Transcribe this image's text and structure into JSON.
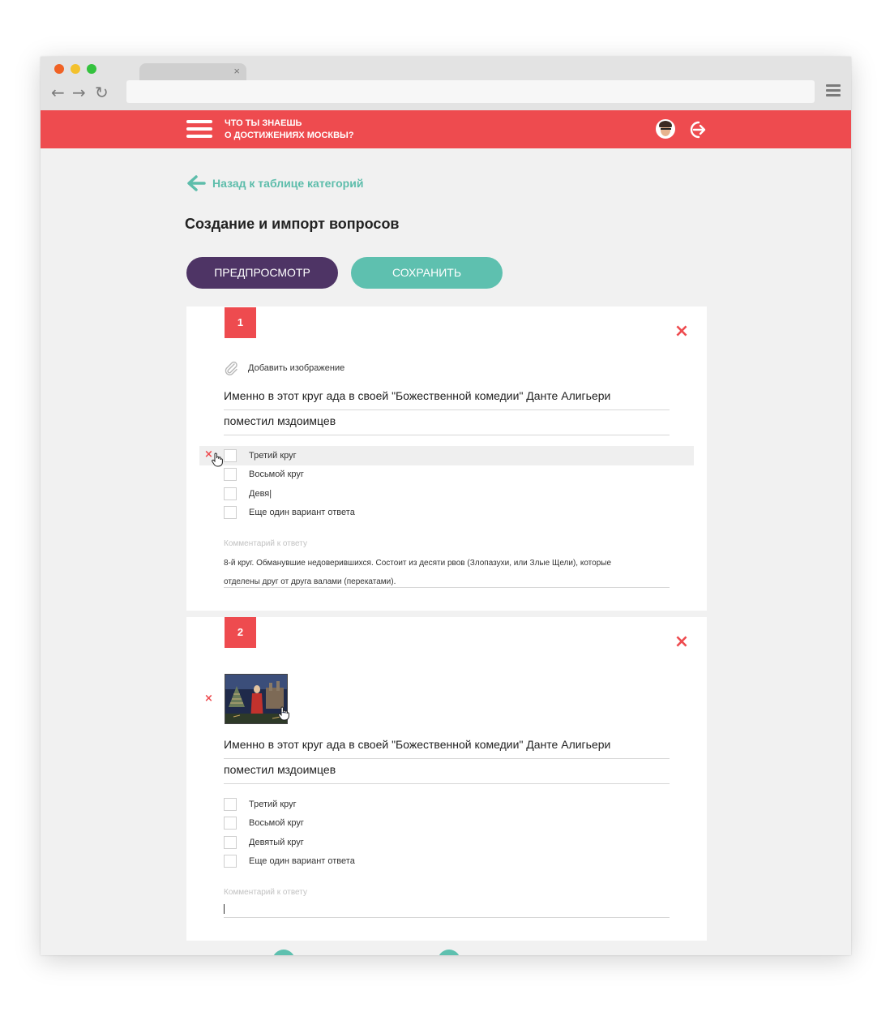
{
  "browser": {
    "tab_close": "×"
  },
  "app": {
    "title_line1": "ЧТО ТЫ ЗНАЕШЬ",
    "title_line2": "О ДОСТИЖЕНИЯХ МОСКВЫ?"
  },
  "nav": {
    "back_label": "Назад к таблице категорий"
  },
  "page": {
    "title": "Создание и импорт вопросов"
  },
  "buttons": {
    "preview": "ПРЕДПРОСМОТР",
    "save": "СОХРАНИТЬ"
  },
  "questions": [
    {
      "number": "1",
      "add_image_label": "Добавить изображение",
      "text_line1": "Именно в этот круг ада в своей \"Божественной комедии\" Данте Алигьери",
      "text_line2": "поместил мздоимцев",
      "answers": [
        {
          "label": "Третий круг"
        },
        {
          "label": "Восьмой круг"
        },
        {
          "label": "Девя|"
        },
        {
          "label": "Еще один вариант ответа"
        }
      ],
      "comment_label": "Комментарий к ответу",
      "comment_line1": "8-й круг. Обманувшие недоверившихся. Состоит из десяти рвов (Злопазухи, или Злые Щели), которые",
      "comment_line2": "отделены друг от друга валами (перекатами)."
    },
    {
      "number": "2",
      "text_line1": "Именно в этот круг ада в своей \"Божественной комедии\" Данте Алигьери",
      "text_line2": "поместил мздоимцев",
      "answers": [
        {
          "label": "Третий круг"
        },
        {
          "label": "Восьмой круг"
        },
        {
          "label": "Девятый круг"
        },
        {
          "label": "Еще один вариант ответа"
        }
      ],
      "comment_label": "Комментарий к ответу"
    }
  ],
  "icons": {
    "close": "×",
    "delete": "×",
    "back_arrow": "←",
    "forward_arrow": "→",
    "reload": "↻"
  },
  "colors": {
    "accent_red": "#ee4b4f",
    "teal": "#5ec0af",
    "purple": "#4e3465",
    "link": "#5dbdab"
  }
}
